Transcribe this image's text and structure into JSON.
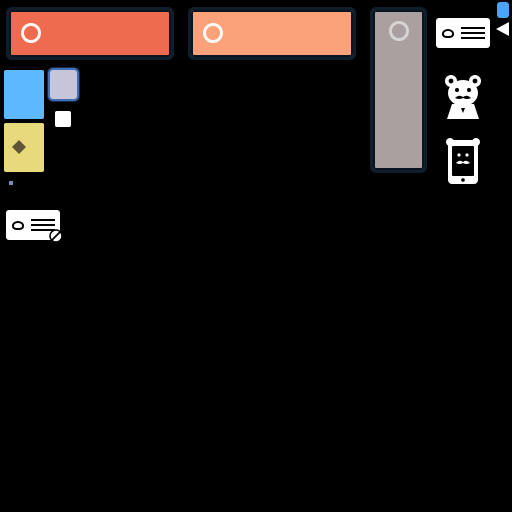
{
  "colors": {
    "background": "#000000",
    "tile_red": "#ee6b50",
    "tile_orange": "#fca27a",
    "tile_grey": "#a9a09f",
    "tile_border": "#0f1d2c",
    "square_blue": "#5eb8ff",
    "square_lavender": "#c7c6d9",
    "square_yellow": "#e8da7a",
    "diamond": "#5f5438",
    "indicator_blue": "#4aa3f5",
    "white": "#ffffff"
  },
  "icons": {
    "tile_ring": "circle-ring-icon",
    "diamond": "diamond-icon",
    "id_card": "id-card-icon",
    "badge": "no-entry-badge-icon",
    "play": "play-triangle-icon",
    "bear": "bear-mustache-icon",
    "phone": "phone-bear-icon"
  }
}
